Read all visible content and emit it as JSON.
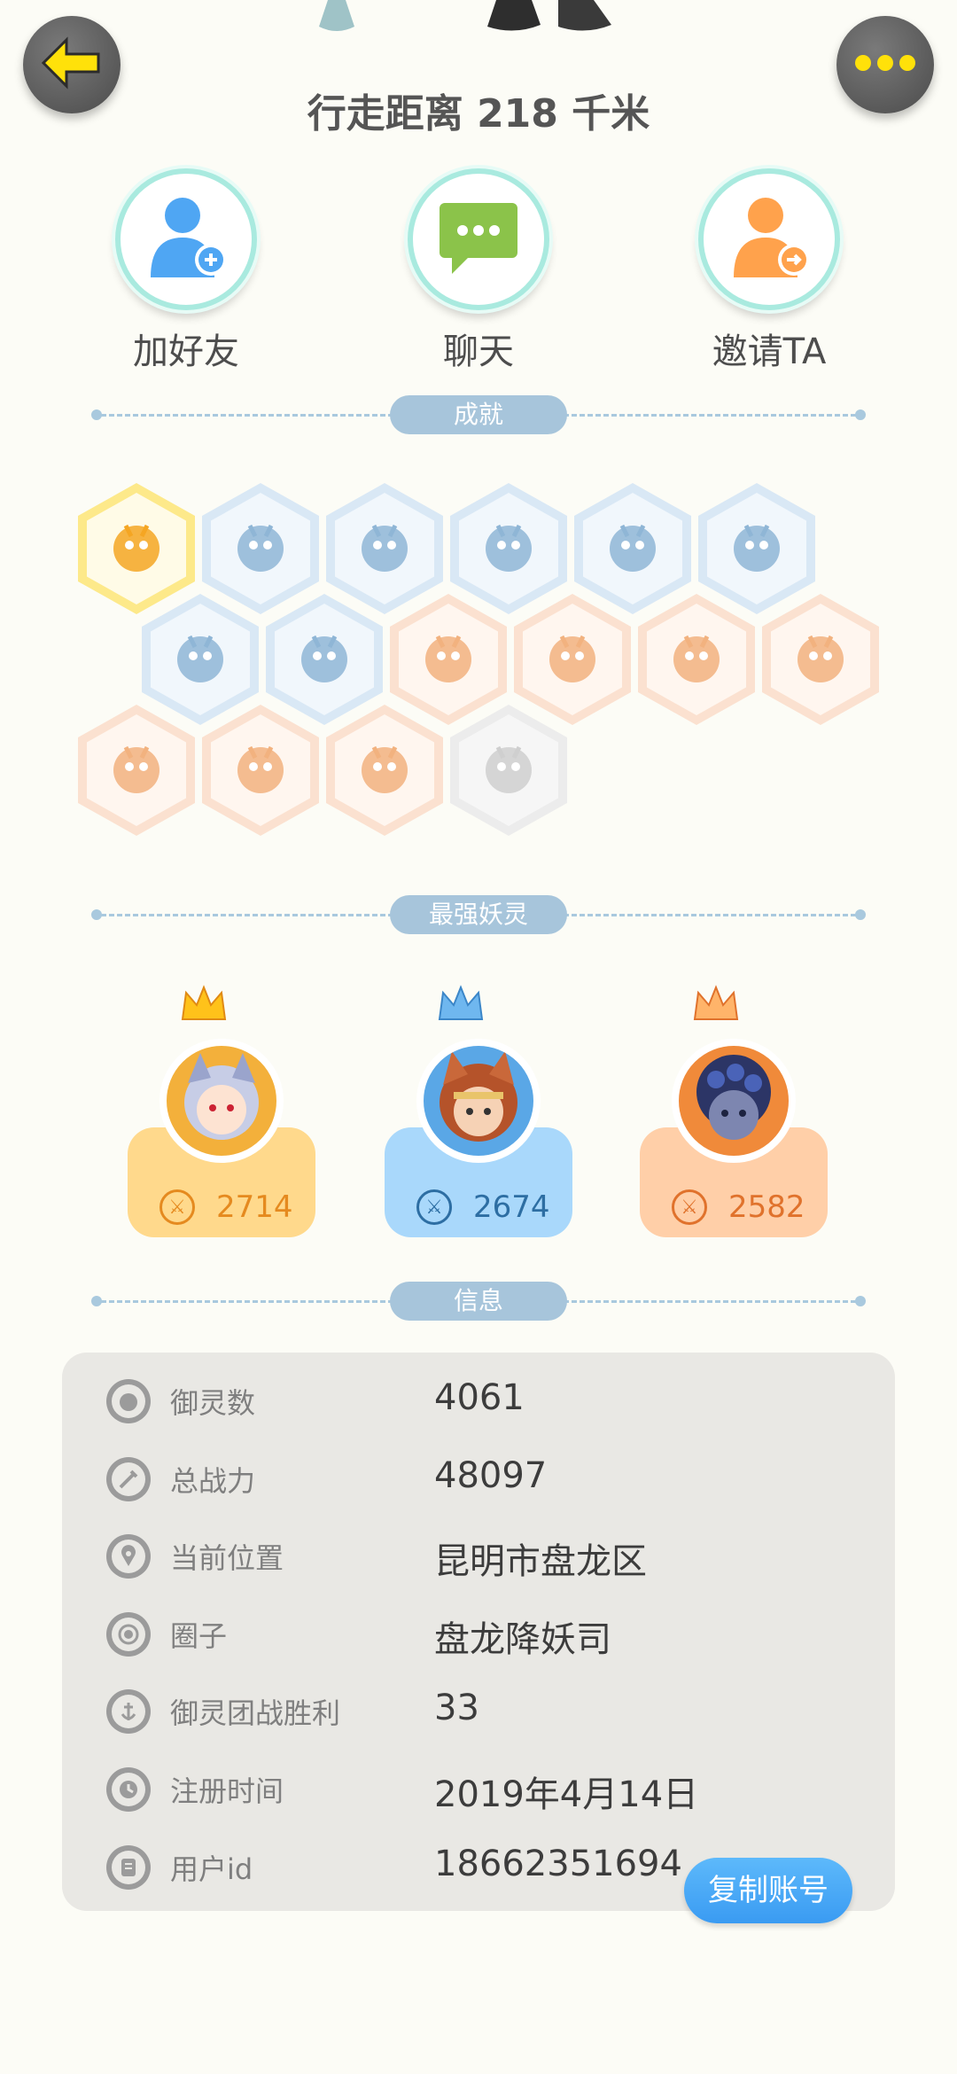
{
  "header": {
    "back_icon": "arrow-left-icon",
    "more_icon": "ellipsis-icon",
    "distance_text": "行走距离 218 千米"
  },
  "actions": [
    {
      "label": "加好友",
      "icon": "add-friend-icon"
    },
    {
      "label": "聊天",
      "icon": "chat-icon"
    },
    {
      "label": "邀请TA",
      "icon": "invite-icon"
    }
  ],
  "sections": {
    "achievements": "成就",
    "strongest": "最强妖灵",
    "info": "信息"
  },
  "achievements": {
    "rows": [
      [
        "gold",
        "blue",
        "blue",
        "blue",
        "blue",
        "blue"
      ],
      [
        "blue",
        "blue",
        "orange",
        "orange",
        "orange",
        "orange"
      ],
      [
        "orange",
        "orange",
        "orange",
        "grey"
      ]
    ]
  },
  "strongest_spirits": [
    {
      "power": "2714",
      "color": "#ffd98c",
      "accent": "#e58a1f"
    },
    {
      "power": "2674",
      "color": "#a9d8fb",
      "accent": "#2d6ea3"
    },
    {
      "power": "2582",
      "color": "#ffcfa8",
      "accent": "#e0722c"
    }
  ],
  "info": {
    "rows": [
      {
        "key": "御灵数",
        "value": "4061",
        "icon": "spirit-count-icon"
      },
      {
        "key": "总战力",
        "value": "48097",
        "icon": "sword-icon"
      },
      {
        "key": "当前位置",
        "value": "昆明市盘龙区",
        "icon": "location-icon"
      },
      {
        "key": "圈子",
        "value": "盘龙降妖司",
        "icon": "circle-icon"
      },
      {
        "key": "御灵团战胜利",
        "value": "33",
        "icon": "anchor-icon"
      },
      {
        "key": "注册时间",
        "value": "2019年4月14日",
        "icon": "clock-icon"
      },
      {
        "key": "用户id",
        "value": "18662351694",
        "icon": "id-card-icon"
      }
    ],
    "copy_label": "复制账号"
  }
}
